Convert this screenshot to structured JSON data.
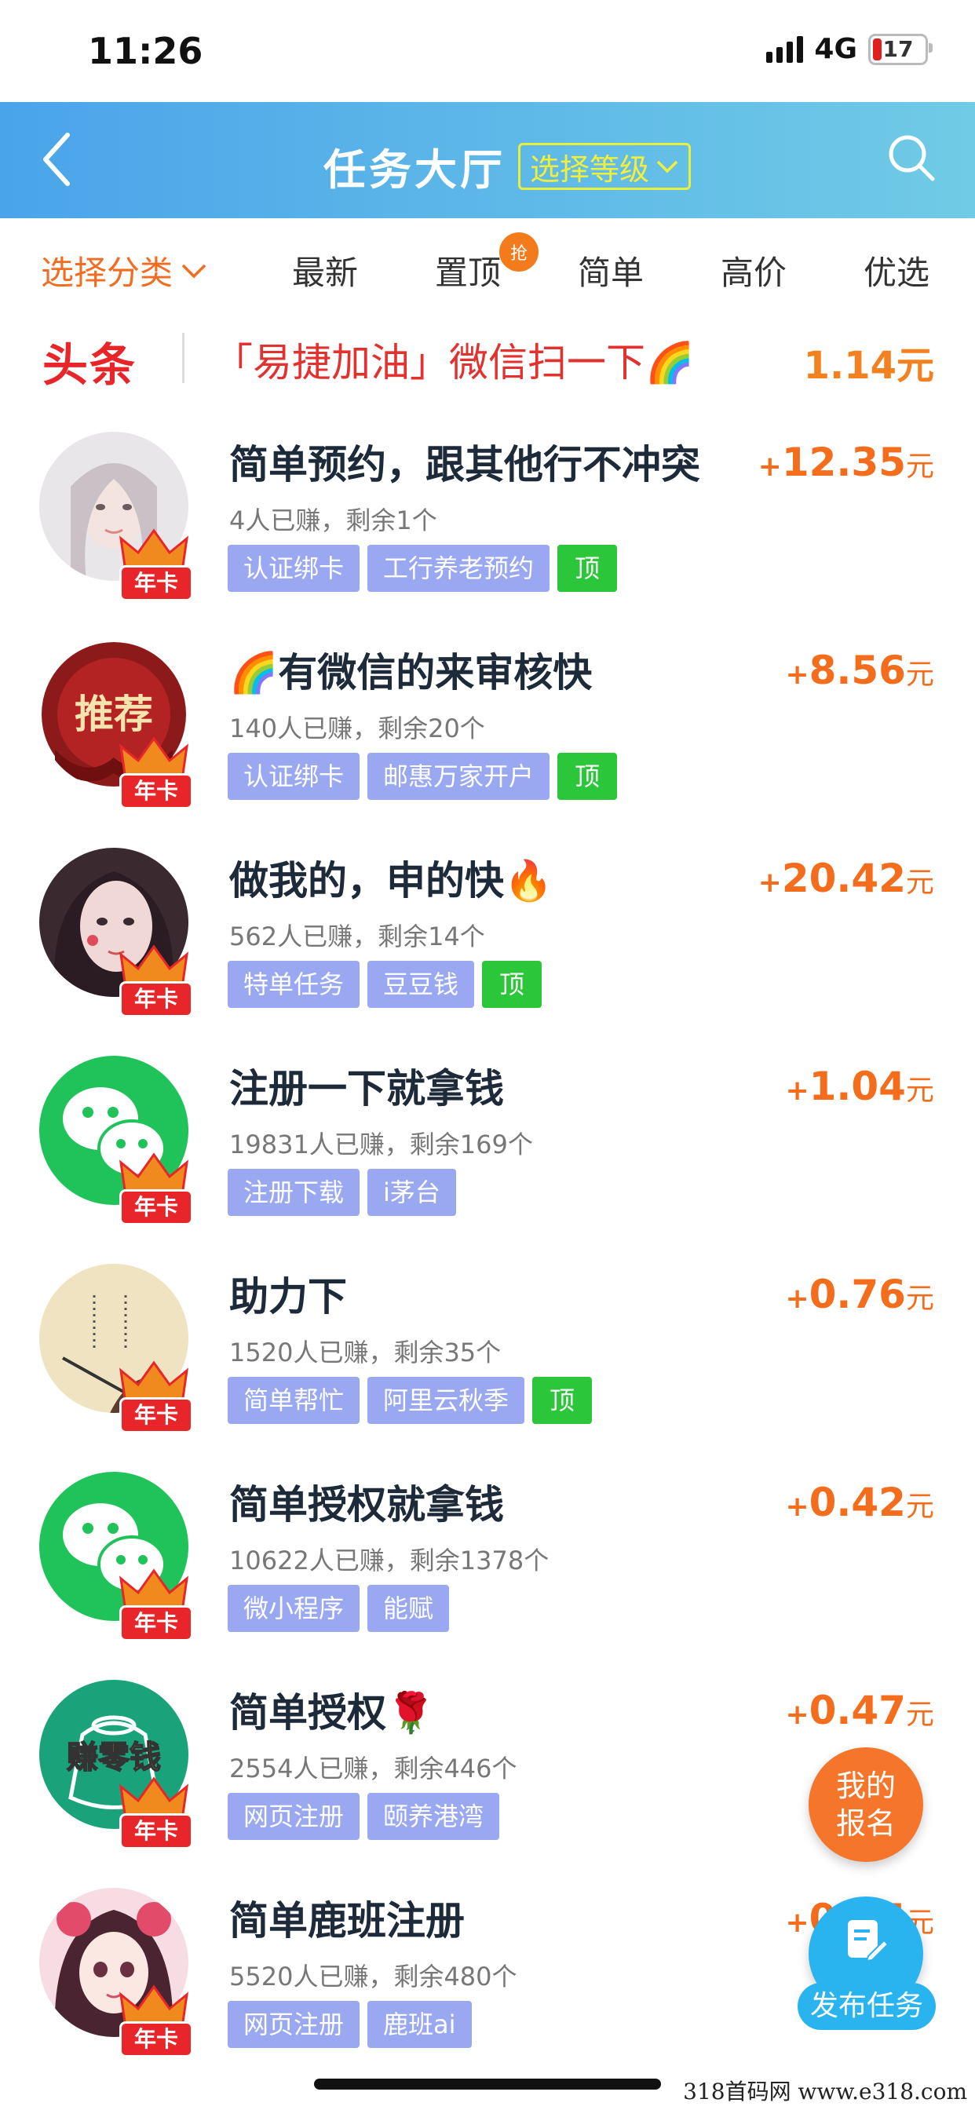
{
  "status": {
    "time": "11:26",
    "network": "4G",
    "battery": "17"
  },
  "header": {
    "title": "任务大厅",
    "level_button": "选择等级"
  },
  "tabs": {
    "category": "选择分类",
    "latest": "最新",
    "top": "置顶",
    "top_badge": "抢",
    "simple": "简单",
    "high": "高价",
    "featured": "优选"
  },
  "headline": {
    "tag": "头条",
    "text": "「易捷加油」微信扫一下🌈",
    "price": "1.14元"
  },
  "colors": {
    "accent": "#f26d21",
    "header_start": "#4aa4ea",
    "header_end": "#70cbe6",
    "tag_blue": "#9aa8f2",
    "tag_green": "#2cc63a",
    "price": "#f46d1c"
  },
  "avatar_badge": "年卡",
  "tasks": [
    {
      "title": "简单预约，跟其他行不冲突",
      "meta": "4人已赚，剩余1个",
      "tags": [
        "认证绑卡",
        "工行养老预约",
        "顶"
      ],
      "plus": "+",
      "price": "12.35",
      "unit": "元"
    },
    {
      "title": "🌈有微信的来审核快",
      "meta": "140人已赚，剩余20个",
      "tags": [
        "认证绑卡",
        "邮惠万家开户",
        "顶"
      ],
      "plus": "+",
      "price": "8.56",
      "unit": "元",
      "avatar_text": "推荐"
    },
    {
      "title": "做我的，申的快🔥",
      "meta": "562人已赚，剩余14个",
      "tags": [
        "特单任务",
        "豆豆钱",
        "顶"
      ],
      "plus": "+",
      "price": "20.42",
      "unit": "元"
    },
    {
      "title": "注册一下就拿钱",
      "meta": "19831人已赚，剩余169个",
      "tags": [
        "注册下载",
        "i茅台"
      ],
      "plus": "+",
      "price": "1.04",
      "unit": "元"
    },
    {
      "title": "助力下",
      "meta": "1520人已赚，剩余35个",
      "tags": [
        "简单帮忙",
        "阿里云秋季",
        "顶"
      ],
      "plus": "+",
      "price": "0.76",
      "unit": "元"
    },
    {
      "title": "简单授权就拿钱",
      "meta": "10622人已赚，剩余1378个",
      "tags": [
        "微小程序",
        "能赋"
      ],
      "plus": "+",
      "price": "0.42",
      "unit": "元"
    },
    {
      "title": "简单授权🌹",
      "meta": "2554人已赚，剩余446个",
      "tags": [
        "网页注册",
        "颐养港湾"
      ],
      "plus": "+",
      "price": "0.47",
      "unit": "元",
      "avatar_text": "赚零钱"
    },
    {
      "title": "简单鹿班注册",
      "meta": "5520人已赚，剩余480个",
      "tags": [
        "网页注册",
        "鹿班ai"
      ],
      "plus": "+",
      "price": "0.55",
      "unit": "元"
    }
  ],
  "float": {
    "apply_line1": "我的",
    "apply_line2": "报名",
    "publish": "发布任务"
  },
  "watermark": "318首码网  www.e318.com"
}
